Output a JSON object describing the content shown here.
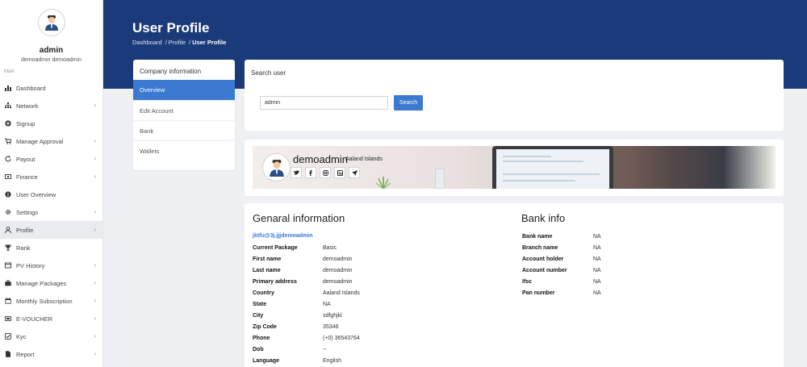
{
  "user": {
    "name": "admin",
    "full_name": "demoadmin demoadmin"
  },
  "sidebar": {
    "section": "Main",
    "items": [
      {
        "label": "Dashboard",
        "icon": "bar-chart-icon",
        "chevron": false
      },
      {
        "label": "Network",
        "icon": "sitemap-icon",
        "chevron": true
      },
      {
        "label": "Signup",
        "icon": "plus-circle-icon",
        "chevron": false
      },
      {
        "label": "Manage Approval",
        "icon": "cart-icon",
        "chevron": true
      },
      {
        "label": "Payout",
        "icon": "refresh-icon",
        "chevron": true
      },
      {
        "label": "Finance",
        "icon": "money-icon",
        "chevron": true
      },
      {
        "label": "User Overview",
        "icon": "info-icon",
        "chevron": false
      },
      {
        "label": "Settings",
        "icon": "gear-icon",
        "chevron": true
      },
      {
        "label": "Profile",
        "icon": "user-icon",
        "chevron": true,
        "active": true
      },
      {
        "label": "Rank",
        "icon": "trophy-icon",
        "chevron": false
      },
      {
        "label": "PV History",
        "icon": "history-icon",
        "chevron": true
      },
      {
        "label": "Manage Packages",
        "icon": "briefcase-icon",
        "chevron": true
      },
      {
        "label": "Monthly Subscription",
        "icon": "calendar-icon",
        "chevron": true
      },
      {
        "label": "E-VOUCHER",
        "icon": "ticket-icon",
        "chevron": true
      },
      {
        "label": "Kyc",
        "icon": "check-icon",
        "chevron": true
      },
      {
        "label": "Report",
        "icon": "file-icon",
        "chevron": true
      }
    ]
  },
  "header": {
    "title": "User Profile",
    "breadcrumb": [
      "Dashboard",
      "Profile",
      "User Profile"
    ]
  },
  "company_menu": {
    "title": "Company information",
    "items": [
      "Overview",
      "Edit Account",
      "Bank",
      "Wallets"
    ],
    "active": "Overview"
  },
  "search": {
    "title": "Search user",
    "value": "admin",
    "button": "Search"
  },
  "cover": {
    "name": "demoadmin",
    "location": "Aaland Islands",
    "social_icons": [
      "twitter-icon",
      "facebook-icon",
      "instagram-icon",
      "linkedin-icon",
      "send-icon"
    ]
  },
  "general": {
    "title": "Genaral information",
    "email": "jktfu@3j.jjjdemoadmin",
    "rows": [
      {
        "key": "Current Package",
        "value": "Basic"
      },
      {
        "key": "First name",
        "value": "demoadmin"
      },
      {
        "key": "Last name",
        "value": "demoadmin"
      },
      {
        "key": "Primary address",
        "value": "demoadmin"
      },
      {
        "key": "Country",
        "value": "Aaland Islands"
      },
      {
        "key": "State",
        "value": "NA"
      },
      {
        "key": "City",
        "value": "sdfghjkl"
      },
      {
        "key": "Zip Code",
        "value": "35346"
      },
      {
        "key": "Phone",
        "value": "(+0) 36543764"
      },
      {
        "key": "Dob",
        "value": "--"
      },
      {
        "key": "Language",
        "value": "English"
      }
    ]
  },
  "bank": {
    "title": "Bank info",
    "rows": [
      {
        "key": "Bank name",
        "value": "NA"
      },
      {
        "key": "Branch name",
        "value": "NA"
      },
      {
        "key": "Account holder",
        "value": "NA"
      },
      {
        "key": "Account number",
        "value": "NA"
      },
      {
        "key": "Ifsc",
        "value": "NA"
      },
      {
        "key": "Pan number",
        "value": "NA"
      }
    ]
  },
  "colors": {
    "header": "#1a3a7a",
    "accent": "#3c7ad1",
    "link": "#3c7ad1"
  }
}
